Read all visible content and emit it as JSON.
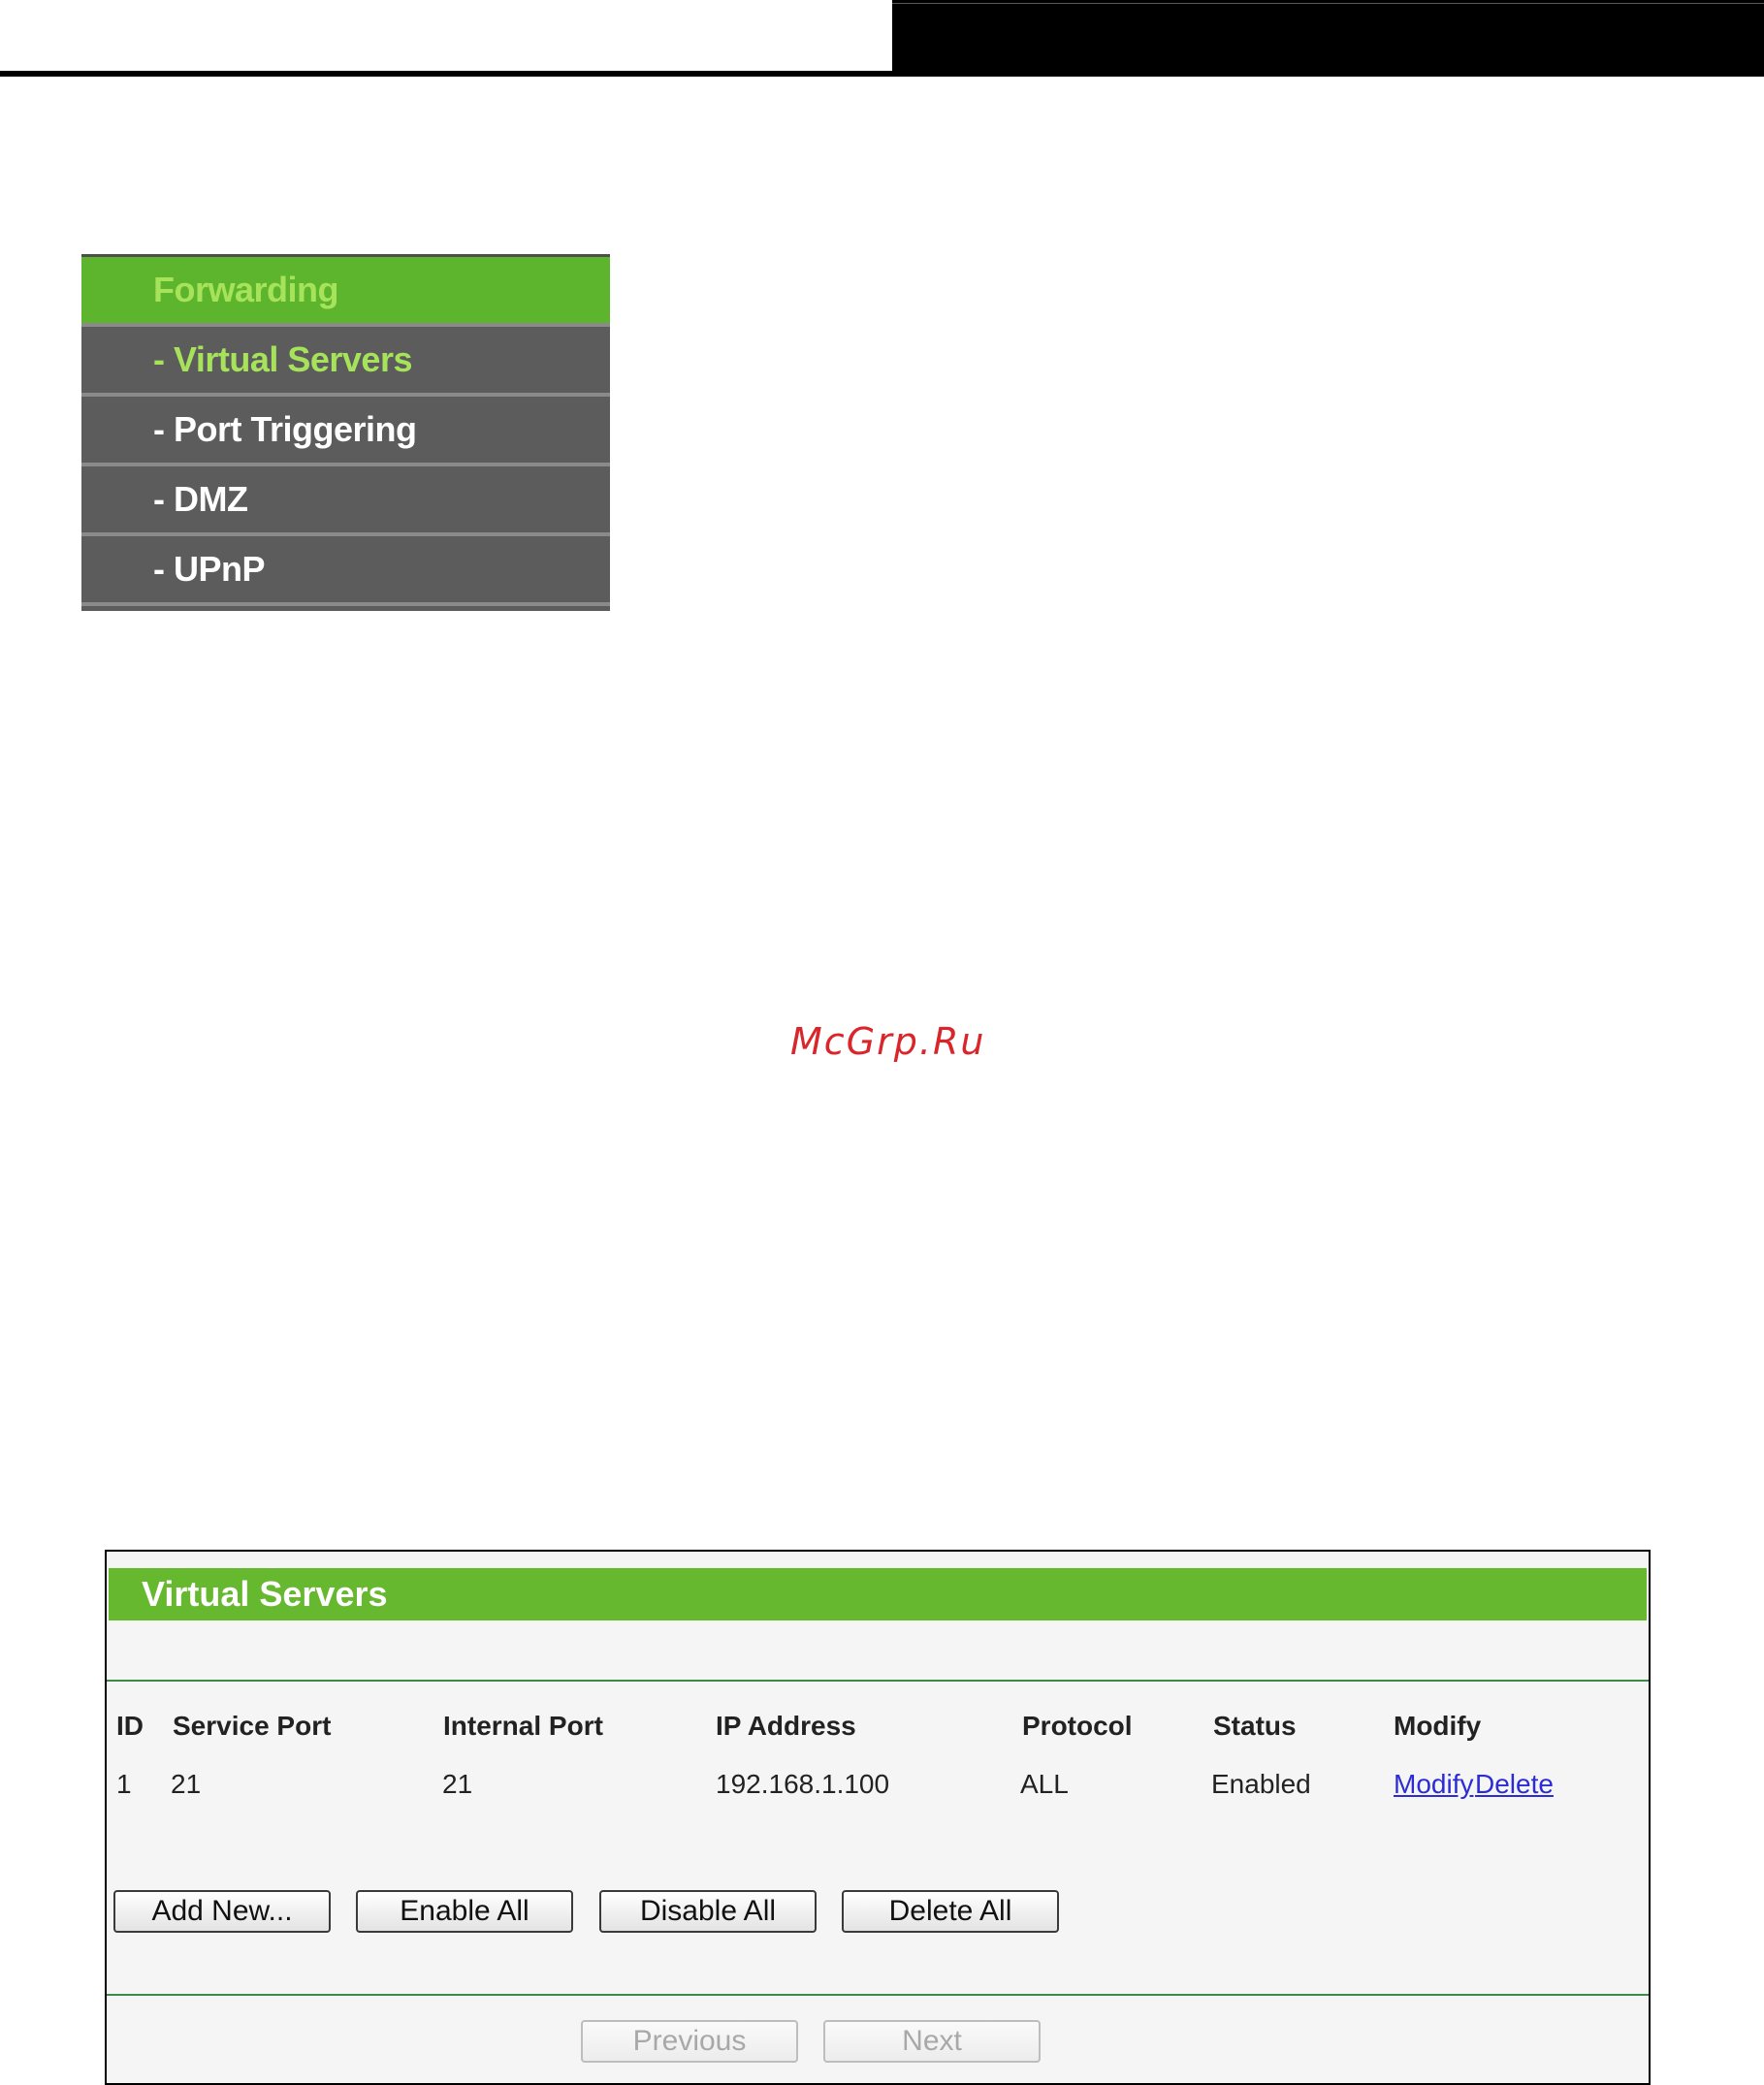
{
  "menu": {
    "header": "Forwarding",
    "items": [
      {
        "label": "- Virtual Servers",
        "active": true
      },
      {
        "label": "- Port Triggering",
        "active": false
      },
      {
        "label": "- DMZ",
        "active": false
      },
      {
        "label": "- UPnP",
        "active": false
      }
    ]
  },
  "watermark": "McGrp.Ru",
  "panel": {
    "title": "Virtual Servers",
    "columns": [
      "ID",
      "Service Port",
      "Internal Port",
      "IP Address",
      "Protocol",
      "Status",
      "Modify"
    ],
    "rows": [
      {
        "id": "1",
        "service_port": "21",
        "internal_port": "21",
        "ip_address": "192.168.1.100",
        "protocol": "ALL",
        "status": "Enabled",
        "modify_label": "Modify",
        "delete_label": "Delete"
      }
    ],
    "buttons": {
      "add_new": "Add New...",
      "enable_all": "Enable All",
      "disable_all": "Disable All",
      "delete_all": "Delete All"
    },
    "pagination": {
      "previous": "Previous",
      "next": "Next"
    }
  },
  "colors": {
    "accent_green": "#66b82f",
    "menu_gray": "#5c5c5c",
    "menu_active_text": "#a6e25a",
    "link_blue": "#2c2cd6",
    "watermark_red": "#d9262b"
  }
}
